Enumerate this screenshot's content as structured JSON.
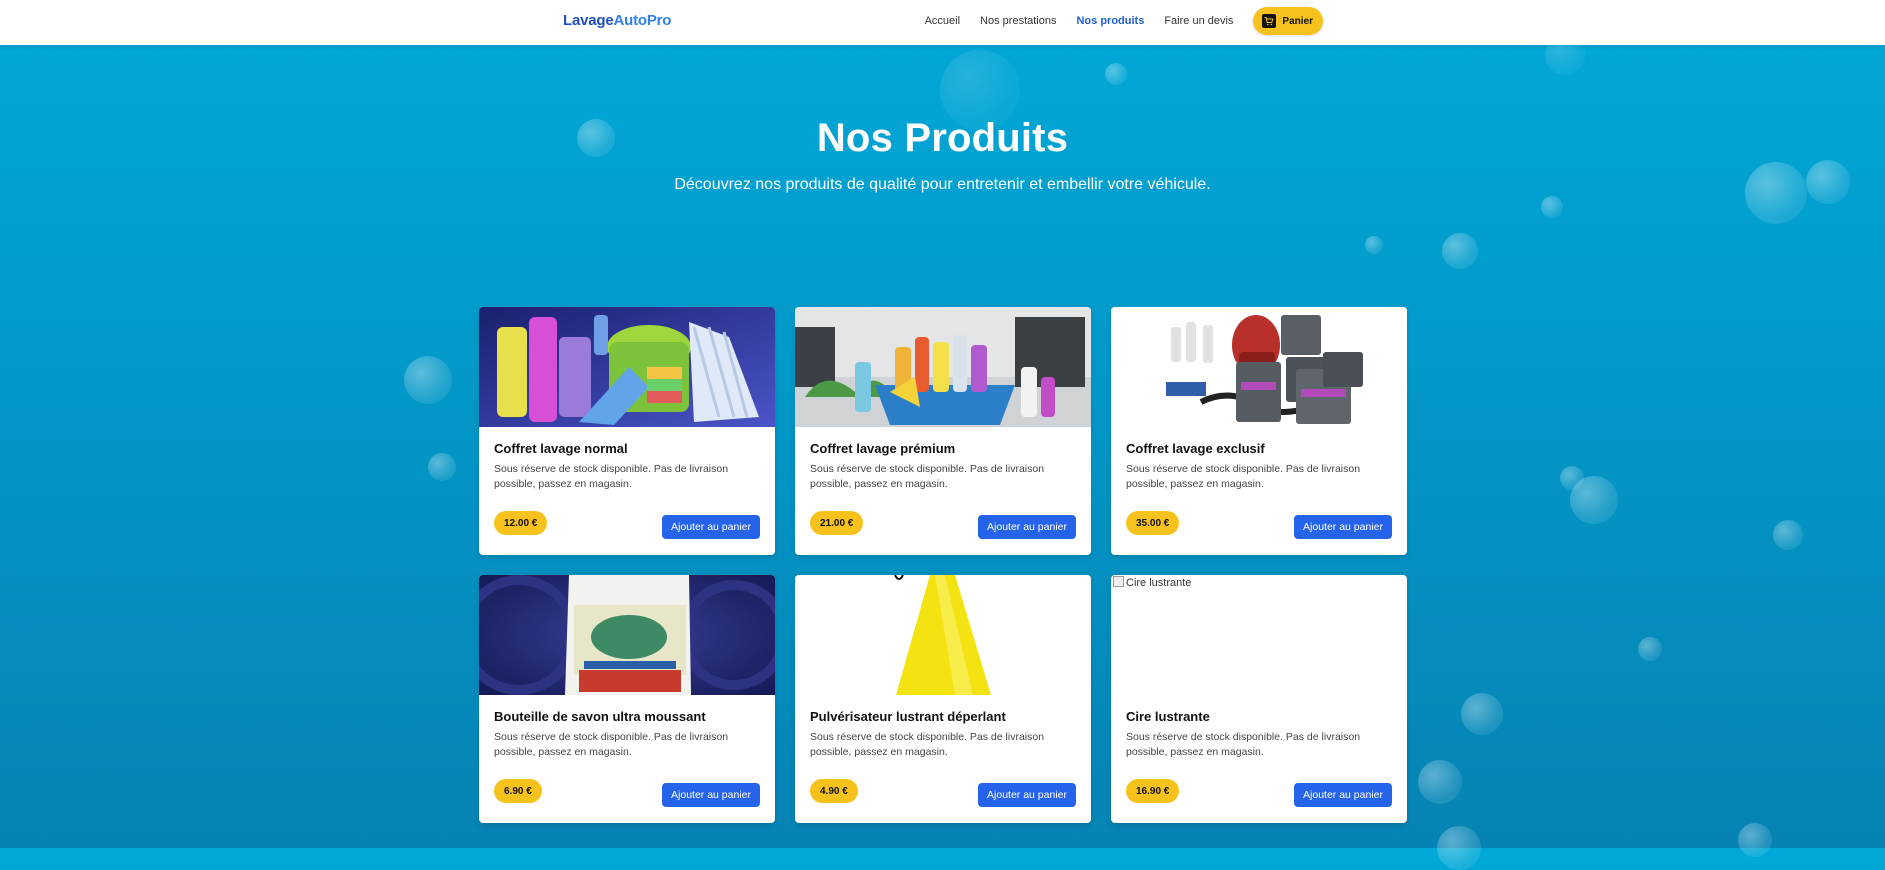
{
  "brand": {
    "part1": "Lavage",
    "part2": "AutoPro"
  },
  "nav": {
    "items": [
      {
        "label": "Accueil",
        "active": false
      },
      {
        "label": "Nos prestations",
        "active": false
      },
      {
        "label": "Nos produits",
        "active": true
      },
      {
        "label": "Faire un devis",
        "active": false
      }
    ],
    "cart_label": "Panier"
  },
  "hero": {
    "title": "Nos Produits",
    "subtitle": "Découvrez nos produits de qualité pour entretenir et embellir votre véhicule."
  },
  "products": [
    {
      "title": "Coffret lavage normal",
      "description": "Sous réserve de stock disponible. Pas de livraison possible, passez en magasin.",
      "price": "12.00 €",
      "button": "Ajouter au panier",
      "image": "cleaning-supplies-image"
    },
    {
      "title": "Coffret lavage prémium",
      "description": "Sous réserve de stock disponible. Pas de livraison possible, passez en magasin.",
      "price": "21.00 €",
      "button": "Ajouter au panier",
      "image": "cleaning-basket-image"
    },
    {
      "title": "Coffret lavage exclusif",
      "description": "Sous réserve de stock disponible. Pas de livraison possible, passez en magasin.",
      "price": "35.00 €",
      "button": "Ajouter au panier",
      "image": "car-care-kit-image"
    },
    {
      "title": "Bouteille de savon ultra moussant",
      "description": "Sous réserve de stock disponible. Pas de livraison possible, passez en magasin.",
      "price": "6.90 €",
      "button": "Ajouter au panier",
      "image": "soap-bottle-image"
    },
    {
      "title": "Pulvérisateur lustrant déperlant",
      "description": "Sous réserve de stock disponible. Pas de livraison possible, passez en magasin.",
      "price": "4.90 €",
      "button": "Ajouter au panier",
      "image": "yellow-sprayer-image"
    },
    {
      "title": "Cire lustrante",
      "description": "Sous réserve de stock disponible. Pas de livraison possible, passez en magasin.",
      "price": "16.90 €",
      "button": "Ajouter au panier",
      "image": "broken-image",
      "image_alt": "Cire lustrante"
    }
  ],
  "colors": {
    "header_bg": "#ffffff",
    "brand": "#1f4fc0",
    "accent_yellow": "#f7c21b",
    "button_blue": "#2563eb",
    "background": "#0398c8"
  }
}
